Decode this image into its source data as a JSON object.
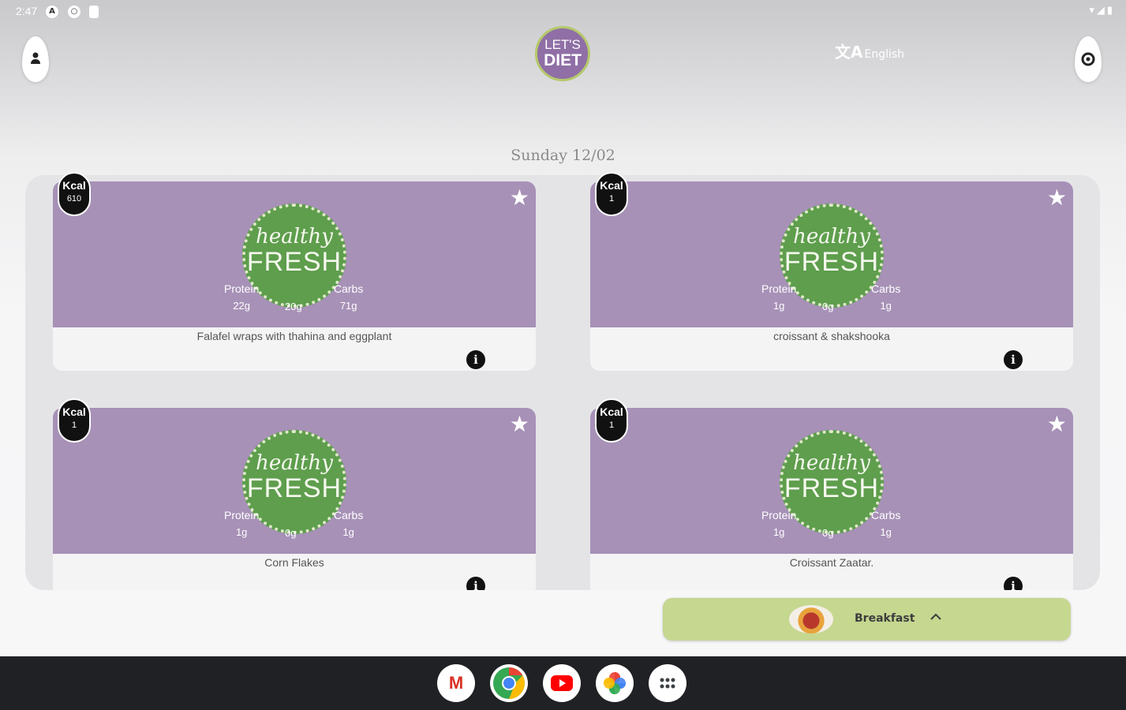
{
  "status_bar": {
    "time": "2:47",
    "icons": [
      "a-icon",
      "circle-icon",
      "battery-saver-icon"
    ],
    "right_icons": "▾◢▮"
  },
  "header": {
    "profile_icon": "person-icon",
    "logo": {
      "line1": "LET'S",
      "line2": "DIET"
    },
    "language": {
      "icon": "文A",
      "label": "English"
    },
    "settings_icon": "settings-icon"
  },
  "date_label": "Sunday 12/02",
  "meals": [
    {
      "kcal_label": "Kcal",
      "kcal": "610",
      "name": "Falafel wraps with thahina and eggplant",
      "protein_label": "Protein",
      "protein": "22g",
      "fat": "20g",
      "carbs_label": "Carbs",
      "carbs": "71g",
      "logo_top": "healthy",
      "logo_bottom": "FRESH"
    },
    {
      "kcal_label": "Kcal",
      "kcal": "1",
      "name": "croissant & shakshooka",
      "protein_label": "Protein",
      "protein": "1g",
      "fat": "0g",
      "carbs_label": "Carbs",
      "carbs": "1g",
      "logo_top": "healthy",
      "logo_bottom": "FRESH"
    },
    {
      "kcal_label": "Kcal",
      "kcal": "1",
      "name": "Corn Flakes",
      "protein_label": "Protein",
      "protein": "1g",
      "fat": "0g",
      "carbs_label": "Carbs",
      "carbs": "1g",
      "logo_top": "healthy",
      "logo_bottom": "FRESH"
    },
    {
      "kcal_label": "Kcal",
      "kcal": "1",
      "name": "Croissant Zaatar.",
      "protein_label": "Protein",
      "protein": "1g",
      "fat": "0g",
      "carbs_label": "Carbs",
      "carbs": "1g",
      "logo_top": "healthy",
      "logo_bottom": "FRESH"
    }
  ],
  "meal_selector": {
    "label": "Breakfast",
    "icon": "chevron-up-icon"
  },
  "taskbar": {
    "apps": [
      "Gmail",
      "Chrome",
      "YouTube",
      "Photos",
      "App drawer"
    ]
  },
  "colors": {
    "card_top": "#a791b7",
    "meal_bar": "#c6d790",
    "logo": "#8f6fa6",
    "emblem": "#5e9e4d"
  }
}
